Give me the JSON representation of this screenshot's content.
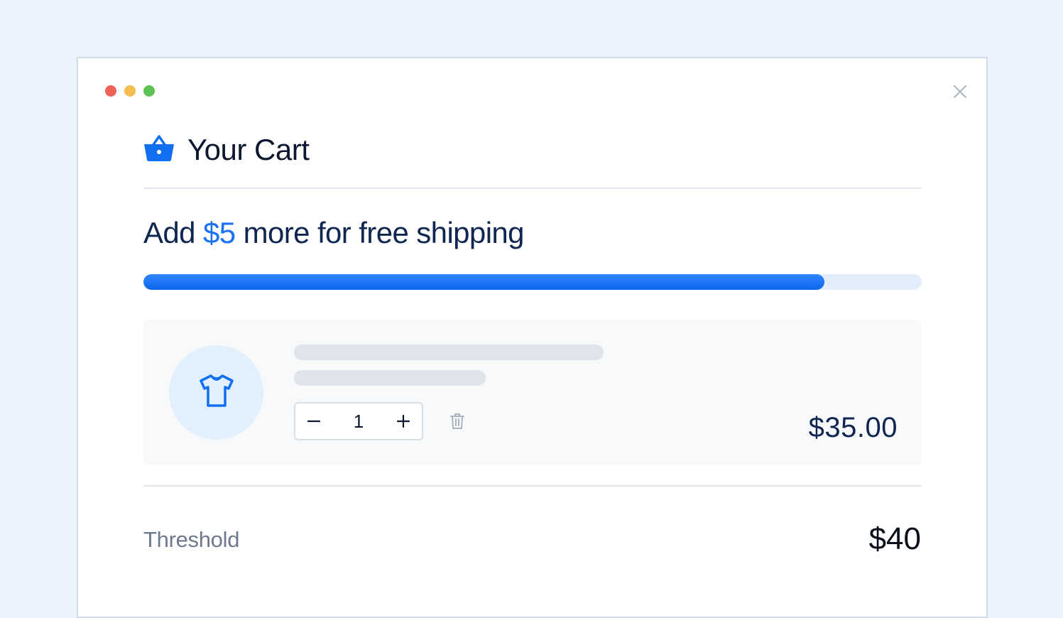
{
  "window": {
    "controls": [
      "close-dot",
      "minimize-dot",
      "maximize-dot"
    ]
  },
  "cart": {
    "title": "Your Cart",
    "icon": "basket-icon"
  },
  "shipping": {
    "prefix": "Add ",
    "amount": "$5",
    "suffix": " more for free shipping",
    "progress_fraction": 0.875
  },
  "item": {
    "icon": "tshirt-icon",
    "quantity": "1",
    "price": "$35.00"
  },
  "summary": {
    "threshold_label": "Threshold",
    "threshold_value": "$40"
  },
  "colors": {
    "accent": "#1872f2",
    "background": "#ebf3fd"
  }
}
